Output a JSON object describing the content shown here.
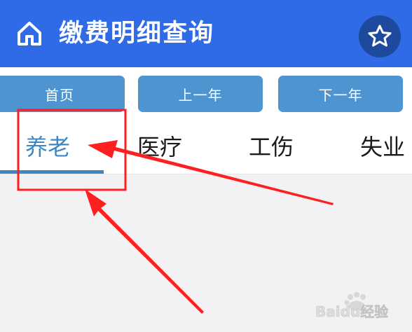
{
  "header": {
    "title": "缴费明细查询",
    "home_icon": "home-icon",
    "favorite_icon": "star-icon",
    "background_color": "#2f6be6"
  },
  "toolbar": {
    "first_label": "首页",
    "prev_year_label": "上一年",
    "next_year_label": "下一年",
    "button_color": "#4e94d0"
  },
  "tabs": {
    "active_index": 0,
    "items": [
      {
        "label": "养老"
      },
      {
        "label": "医疗"
      },
      {
        "label": "工伤"
      },
      {
        "label": "失业"
      }
    ],
    "active_color": "#3e86c4"
  },
  "annotation": {
    "highlight_box_color": "#ff1f1f",
    "arrow_color": "#ff1f1f"
  },
  "watermark": {
    "text": "Baidu经验"
  }
}
